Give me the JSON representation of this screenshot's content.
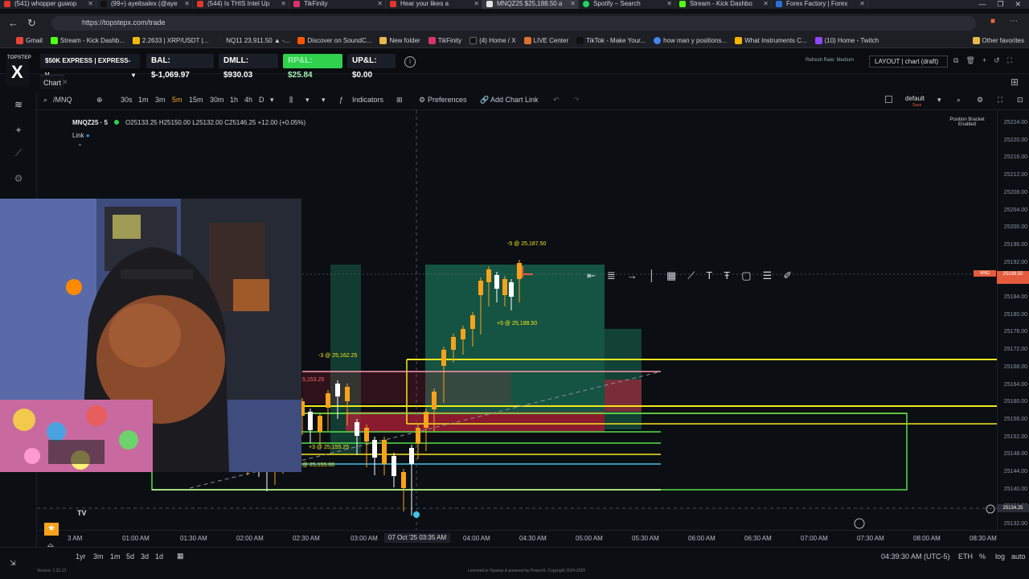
{
  "browser": {
    "tabs": [
      {
        "title": "(541) whopper guwop"
      },
      {
        "title": "(99+) ayeitsalex (@aye"
      },
      {
        "title": "(544) Is THIS Intel Up"
      },
      {
        "title": "TikFinity"
      },
      {
        "title": "Hear your likes a"
      },
      {
        "title": "MNQZ25 $25,188.50 a"
      },
      {
        "title": "Spotify – Search"
      },
      {
        "title": "Stream - Kick Dashbo"
      },
      {
        "title": "Forex Factory | Forex"
      }
    ],
    "url": "https://topstepx.com/trade",
    "bookmarks": [
      "Gmail",
      "Stream - Kick Dashb...",
      "2.2633 | XRP/USDT |...",
      "NQ11 23,911.50 ▲ -...",
      "Discover on SoundC...",
      "New folder",
      "TikFinity",
      "(4) Home / X",
      "LIVE Center",
      "TikTok - Make Your...",
      "how man y positions...",
      "What Instruments C...",
      "(10) Home - Twitch",
      "Other favorites"
    ]
  },
  "app": {
    "logo_top": "TOPSTEP",
    "logo_letter": "X",
    "account": "$50K EXPRESS | EXPRESS-V...",
    "bal": "BAL: $-1,069.97",
    "dmll": "DMLL: $930.03",
    "rpnl": "RP&L: $25.84",
    "upnl": "UP&L: $0.00",
    "refresh": "Refresh Rate: Medium",
    "layout": "LAYOUT | chart (draft)",
    "chart_tab": "Chart"
  },
  "toolbar": {
    "symbol": "/MNQ",
    "timeframes": [
      "30s",
      "1m",
      "3m",
      "5m",
      "15m",
      "30m",
      "1h",
      "4h",
      "D"
    ],
    "indicators": "Indicators",
    "preferences": "Preferences",
    "add_chart_link": "Add Chart Link",
    "default_label": "default",
    "default_sub": "Save"
  },
  "chart": {
    "symbol_tf": "MNQZ25 · 5",
    "ohlc": "O25133.25  H25150.00  L25132.00  C25146.25  +12.00 (+0.05%)",
    "link": "Link",
    "position_bracket": "Position Bracket Enabled",
    "orders": [
      {
        "label": "-5 @ 25,187.50"
      },
      {
        "label": "+5 @ 25,188.50"
      },
      {
        "label": "-3 @ 25,162.25"
      },
      {
        "label": "5,153.25"
      },
      {
        "label": "+3 @ 25,155.25"
      },
      {
        "label": "+3 @ 25,155.00"
      }
    ],
    "current_price": "25188.50",
    "cur_tag": "MNQ",
    "cross_price": "25134.25",
    "cursor_time": "07 Oct '25 03:35 AM",
    "price_labels": [
      "25224.00",
      "25220.00",
      "25216.00",
      "25212.00",
      "25208.00",
      "25204.00",
      "25200.00",
      "25196.00",
      "25192.00",
      "25188.00",
      "25184.00",
      "25180.00",
      "25176.00",
      "25172.00",
      "25168.00",
      "25164.00",
      "25160.00",
      "25156.00",
      "25152.00",
      "25148.00",
      "25144.00",
      "25140.00",
      "25136.00",
      "25132.00"
    ],
    "time_labels": [
      "3 AM",
      "01:00 AM",
      "01:30 AM",
      "02:00 AM",
      "02:30 AM",
      "03:00 AM",
      "04:00 AM",
      "04:30 AM",
      "05:00 AM",
      "05:30 AM",
      "06:00 AM",
      "06:30 AM",
      "07:00 AM",
      "07:30 AM",
      "08:00 AM",
      "08:30 AM"
    ]
  },
  "bottom": {
    "ranges": [
      "1yr",
      "3m",
      "1m",
      "5d",
      "3d",
      "1d"
    ],
    "clock": "04:39:30 AM (UTC-5)",
    "session": "ETH",
    "log": "log",
    "auto": "auto"
  },
  "footer": {
    "version": "Version: 1.22.13",
    "license": "Licensed to Topstep & powered by ProjectX. Copyright 2024-2025"
  },
  "colors": {
    "accent": "#2fd14d",
    "orange": "#e45b3d",
    "yellow": "#f5e61e",
    "bull": "#f7a21b",
    "bear": "#ffffff"
  }
}
